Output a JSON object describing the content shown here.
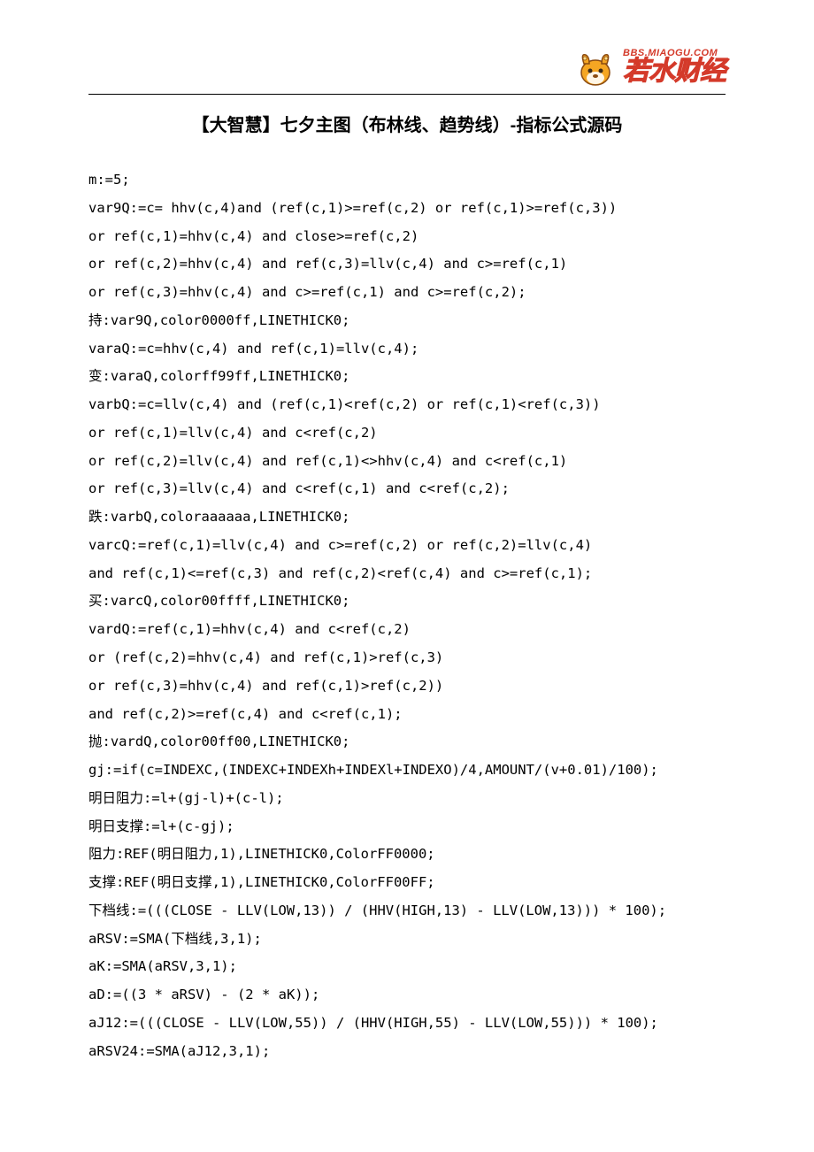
{
  "header": {
    "logo_url": "BBS.MIAOGU.COM",
    "logo_name": "若水财经"
  },
  "title": "【大智慧】七夕主图（布林线、趋势线）-指标公式源码",
  "code_lines": [
    "m:=5;",
    "var9Q:=c= hhv(c,4)and (ref(c,1)>=ref(c,2) or ref(c,1)>=ref(c,3))",
    "or ref(c,1)=hhv(c,4) and close>=ref(c,2)",
    "or ref(c,2)=hhv(c,4) and ref(c,3)=llv(c,4) and c>=ref(c,1)",
    "or ref(c,3)=hhv(c,4) and c>=ref(c,1) and c>=ref(c,2);",
    "持:var9Q,color0000ff,LINETHICK0;",
    "varaQ:=c=hhv(c,4) and ref(c,1)=llv(c,4);",
    "变:varaQ,colorff99ff,LINETHICK0;",
    "varbQ:=c=llv(c,4) and (ref(c,1)<ref(c,2) or ref(c,1)<ref(c,3))",
    "or ref(c,1)=llv(c,4) and c<ref(c,2)",
    "or ref(c,2)=llv(c,4) and ref(c,1)<>hhv(c,4) and c<ref(c,1)",
    "or ref(c,3)=llv(c,4) and c<ref(c,1) and c<ref(c,2);",
    "跌:varbQ,coloraaaaaa,LINETHICK0;",
    "varcQ:=ref(c,1)=llv(c,4) and c>=ref(c,2) or ref(c,2)=llv(c,4)",
    "and ref(c,1)<=ref(c,3) and ref(c,2)<ref(c,4) and c>=ref(c,1);",
    "买:varcQ,color00ffff,LINETHICK0;",
    "vardQ:=ref(c,1)=hhv(c,4) and c<ref(c,2)",
    "or (ref(c,2)=hhv(c,4) and ref(c,1)>ref(c,3)",
    "or ref(c,3)=hhv(c,4) and ref(c,1)>ref(c,2))",
    "and ref(c,2)>=ref(c,4) and c<ref(c,1);",
    "抛:vardQ,color00ff00,LINETHICK0;",
    "gj:=if(c=INDEXC,(INDEXC+INDEXh+INDEXl+INDEXO)/4,AMOUNT/(v+0.01)/100);",
    "明日阻力:=l+(gj-l)+(c-l);",
    "明日支撑:=l+(c-gj);",
    "阻力:REF(明日阻力,1),LINETHICK0,ColorFF0000;",
    "支撑:REF(明日支撑,1),LINETHICK0,ColorFF00FF;",
    "下档线:=(((CLOSE - LLV(LOW,13)) / (HHV(HIGH,13) - LLV(LOW,13))) * 100);",
    "aRSV:=SMA(下档线,3,1);",
    "aK:=SMA(aRSV,3,1);",
    "aD:=((3 * aRSV) - (2 * aK));",
    "aJ12:=(((CLOSE - LLV(LOW,55)) / (HHV(HIGH,55) - LLV(LOW,55))) * 100);",
    "aRSV24:=SMA(aJ12,3,1);"
  ]
}
